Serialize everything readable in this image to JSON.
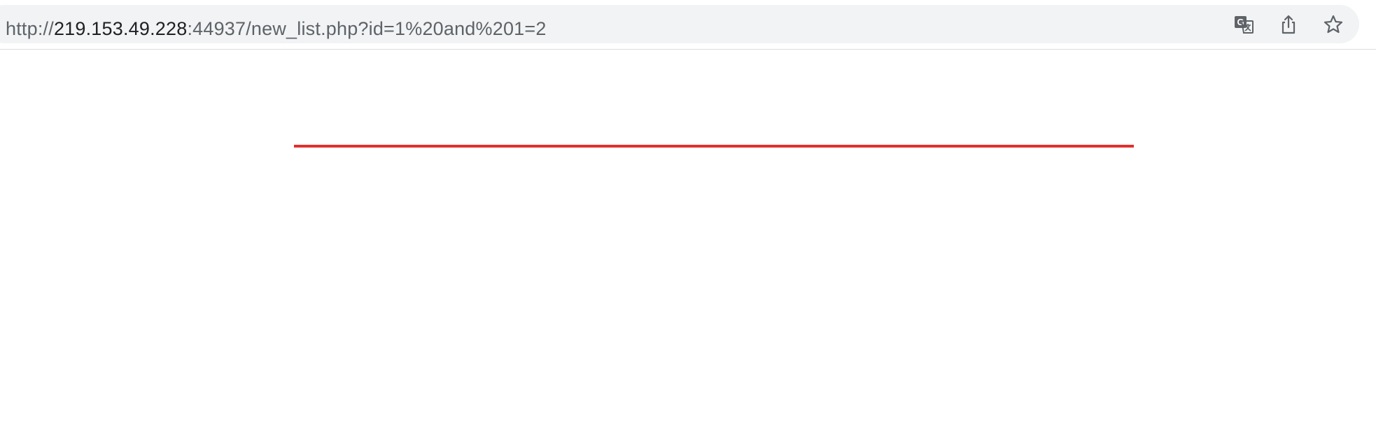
{
  "browser": {
    "address_bar": {
      "scheme": "http://",
      "host": "219.153.49.228",
      "rest": ":44937/new_list.php?id=1%20and%201=2"
    },
    "icons": {
      "translate": "translate-icon",
      "share": "share-icon",
      "bookmark": "star-icon"
    }
  },
  "page": {
    "accent_color": "#e0312c"
  }
}
